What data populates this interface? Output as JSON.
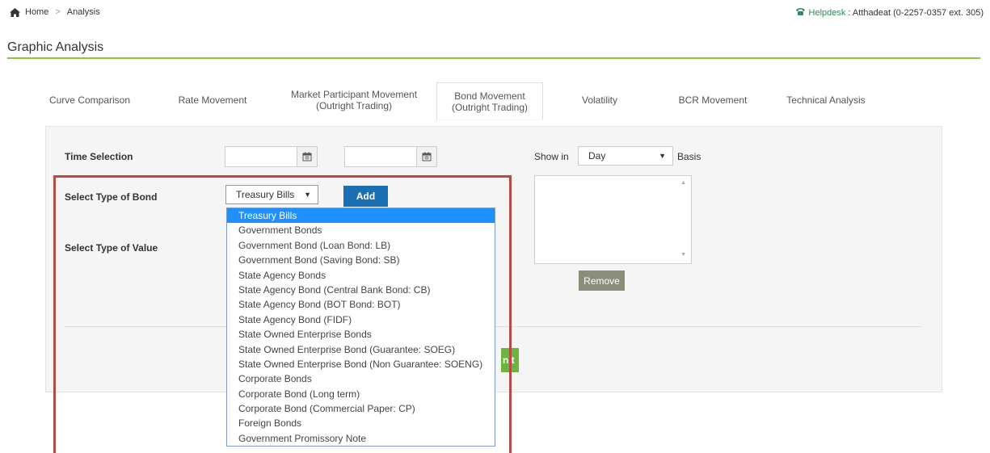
{
  "breadcrumb": {
    "home": "Home",
    "sep": ">",
    "current": "Analysis"
  },
  "helpdesk": {
    "label": "Helpdesk",
    "text": " : Atthadeat (0-2257-0357 ext. 305)"
  },
  "page": {
    "title": "Graphic Analysis"
  },
  "tabs": [
    {
      "line1": "Curve Comparison",
      "line2": ""
    },
    {
      "line1": "Rate Movement",
      "line2": ""
    },
    {
      "line1": "Market Participant Movement",
      "line2": "(Outright Trading)"
    },
    {
      "line1": "Bond Movement",
      "line2": "(Outright Trading)"
    },
    {
      "line1": "Volatility",
      "line2": ""
    },
    {
      "line1": "BCR Movement",
      "line2": ""
    },
    {
      "line1": "Technical Analysis",
      "line2": ""
    }
  ],
  "form": {
    "time_selection": "Time Selection",
    "show_in": "Show in",
    "basis_value": "Day",
    "basis": "Basis",
    "type_of_bond": "Select Type of Bond",
    "type_of_bond_value": "Treasury Bills",
    "type_of_value": "Select Type of Value",
    "add": "Add",
    "remove": "Remove",
    "submit": "nit"
  },
  "dropdown_options": [
    "Treasury Bills",
    "Government Bonds",
    "Government Bond (Loan Bond: LB)",
    "Government Bond (Saving Bond: SB)",
    "State Agency Bonds",
    "State Agency Bond (Central Bank Bond: CB)",
    "State Agency Bond (BOT Bond: BOT)",
    "State Agency Bond (FIDF)",
    "State Owned Enterprise Bonds",
    "State Owned Enterprise Bond (Guarantee: SOEG)",
    "State Owned Enterprise Bond (Non Guarantee: SOENG)",
    "Corporate Bonds",
    "Corporate Bond (Long term)",
    "Corporate Bond (Commercial Paper: CP)",
    "Foreign Bonds",
    "Government Promissory Note"
  ],
  "colors": {
    "accent": "#8cc63f",
    "primary": "#1a6fb2",
    "highlight": "#b94a48",
    "selected": "#1e90ff"
  }
}
